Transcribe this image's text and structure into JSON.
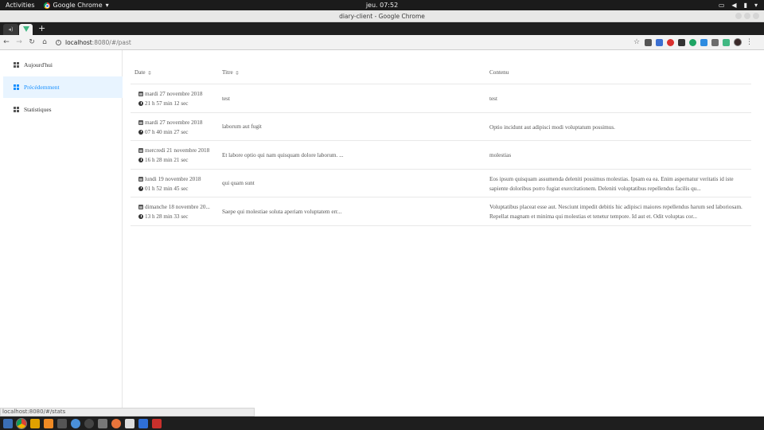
{
  "system": {
    "activities": "Activities",
    "app_name": "Google Chrome",
    "clock": "jeu. 07:52"
  },
  "window": {
    "title": "diary-client - Google Chrome"
  },
  "browser": {
    "url_host": "localhost",
    "url_rest": ":8080/#/past",
    "status_url": "localhost:8080/#/stats"
  },
  "sidebar": {
    "items": [
      {
        "label": "Aujourd'hui",
        "active": false
      },
      {
        "label": "Précédemment",
        "active": true
      },
      {
        "label": "Statistiques",
        "active": false
      }
    ]
  },
  "table": {
    "headers": {
      "date": "Date",
      "title": "Titre",
      "content": "Contenu"
    },
    "rows": [
      {
        "date": "mardi 27 novembre 2018",
        "duration": "21 h 57 min 12 sec",
        "title": "test",
        "content": "test"
      },
      {
        "date": "mardi 27 novembre 2018",
        "duration": "07 h 40 min 27 sec",
        "title": "laborum aut fugit",
        "content": "Optio incidunt aut adipisci modi voluptatum possimus."
      },
      {
        "date": "mercredi 21 novembre 2018",
        "duration": "16 h 28 min 21 sec",
        "title": "Et labore optio qui nam quisquam dolore laborum. ...",
        "content": "molestias"
      },
      {
        "date": "lundi 19 novembre 2018",
        "duration": "01 h 52 min 45 sec",
        "title": "qui quam sunt",
        "content": "Eos ipsum quisquam assumenda deleniti possimus molestias. Ipsam ea ea. Enim aspernatur veritatis id iste sapiente doloribus porro fugiat exercitationem. Deleniti voluptatibus repellendus facilis qu..."
      },
      {
        "date": "dimanche 18 novembre 20...",
        "duration": "13 h 28 min 33 sec",
        "title": "Saepe qui molestiae soluta aperiam voluptatem err...",
        "content": "Voluptatibus placeat esse aut. Nesciunt impedit debitis hic adipisci maiores repellendus harum sed laboriosam. Repellat magnam et minima qui molestias et tenetur tempore. Id aut et. Odit voluptas cor..."
      }
    ]
  },
  "colors": {
    "accent": "#1890ff",
    "active_bg": "#e8f4ff",
    "vue_green": "#41b883"
  }
}
